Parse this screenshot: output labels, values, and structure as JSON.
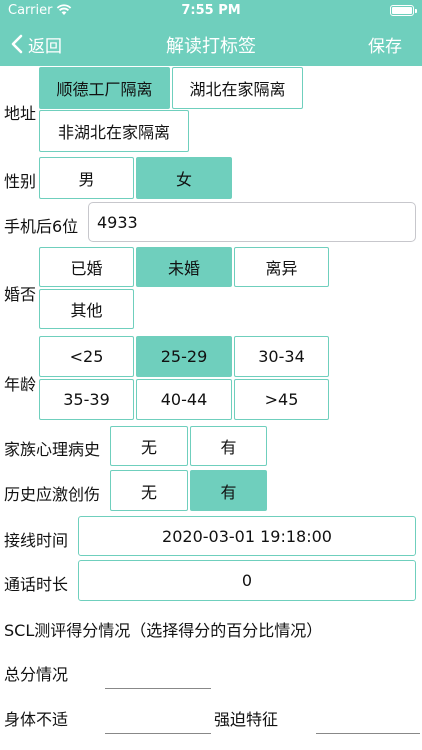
{
  "status_bar": {
    "carrier": "Carrier",
    "time": "7:55 PM"
  },
  "nav": {
    "back_label": "返回",
    "title": "解读打标签",
    "save_label": "保存"
  },
  "address": {
    "label": "地址",
    "options": [
      "顺德工厂隔离",
      "湖北在家隔离",
      "非湖北在家隔离"
    ],
    "selected": 0
  },
  "gender": {
    "label": "性别",
    "options": [
      "男",
      "女"
    ],
    "selected": 1
  },
  "phone": {
    "label": "手机后6位",
    "value": "4933"
  },
  "marital": {
    "label": "婚否",
    "options": [
      "已婚",
      "未婚",
      "离异",
      "其他"
    ],
    "selected": 1
  },
  "age": {
    "label": "年龄",
    "options": [
      "<25",
      "25-29",
      "30-34",
      "35-39",
      "40-44",
      ">45"
    ],
    "selected": 1
  },
  "family_history": {
    "label": "家族心理病史",
    "options": [
      "无",
      "有"
    ],
    "selected": -1
  },
  "stress_history": {
    "label": "历史应激创伤",
    "options": [
      "无",
      "有"
    ],
    "selected": 1
  },
  "call_time": {
    "label": "接线时间",
    "value": "2020-03-01 19:18:00"
  },
  "call_duration": {
    "label": "通话时长",
    "value": "0"
  },
  "scl": {
    "heading": "SCL测评得分情况（选择得分的百分比情况）",
    "total_label": "总分情况",
    "somatic_label": "身体不适",
    "obsessive_label": "强迫特征"
  },
  "colors": {
    "accent": "#6fcfbd",
    "white": "#ffffff"
  }
}
